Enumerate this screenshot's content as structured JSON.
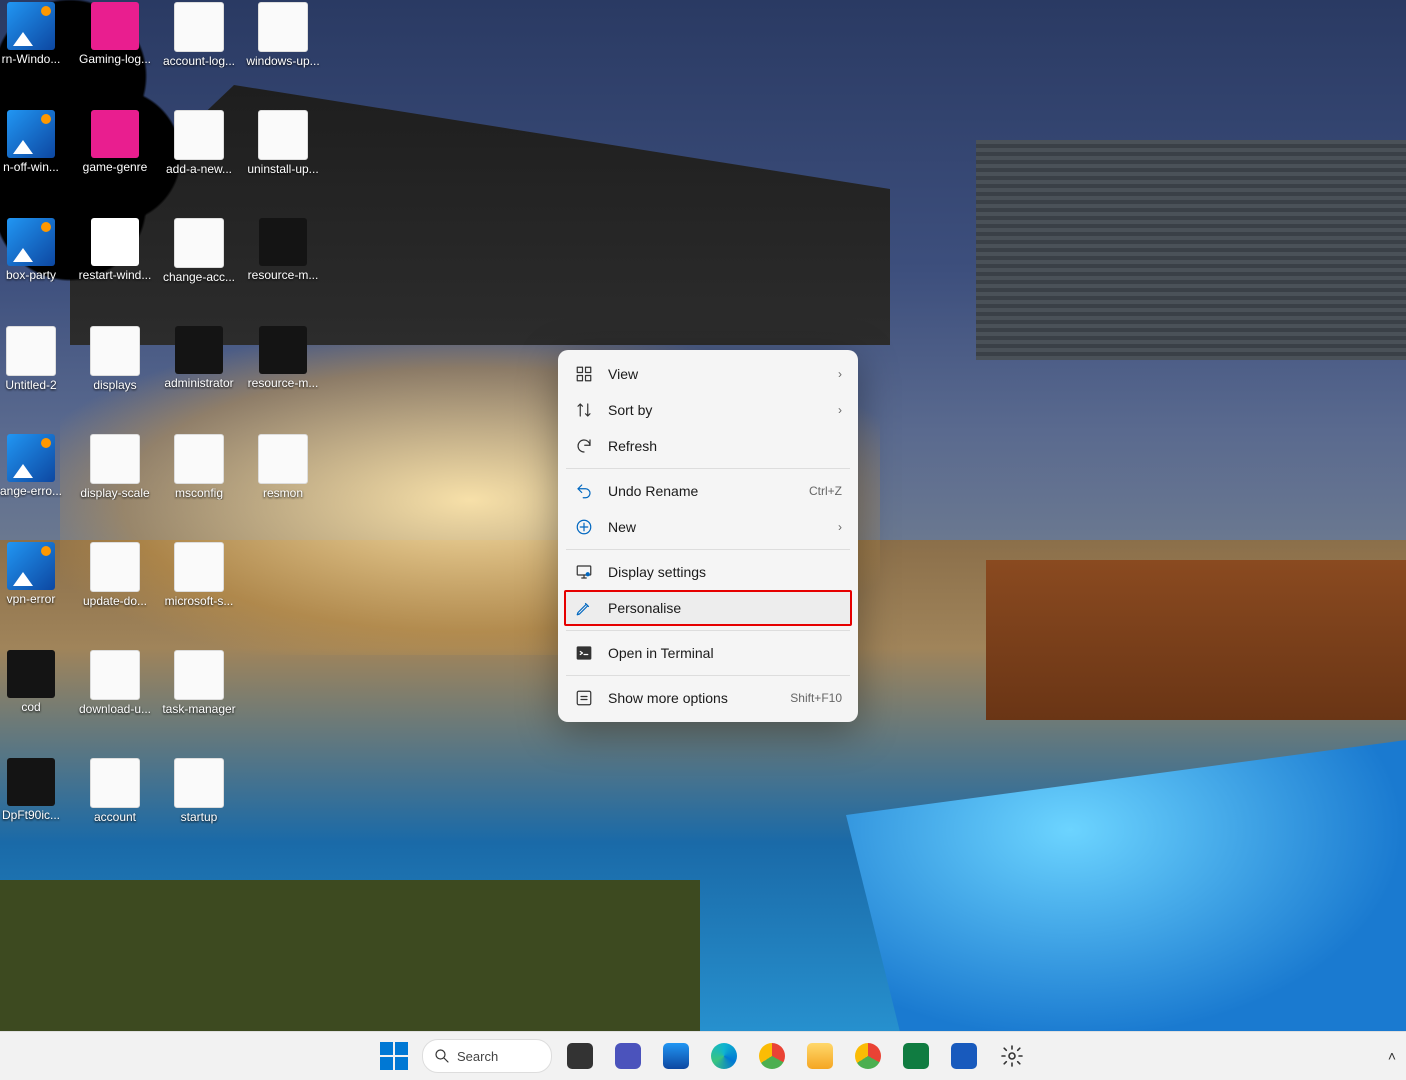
{
  "desktop_icons": [
    [
      {
        "label": "rn-Windo...",
        "type": "image"
      },
      {
        "label": "Gaming-log...",
        "type": "pink"
      },
      {
        "label": "account-log...",
        "type": "doc"
      },
      {
        "label": "windows-up...",
        "type": "doc"
      }
    ],
    [
      {
        "label": "n-off-win...",
        "type": "image"
      },
      {
        "label": "game-genre",
        "type": "pink"
      },
      {
        "label": "add-a-new...",
        "type": "doc"
      },
      {
        "label": "uninstall-up...",
        "type": "doc"
      }
    ],
    [
      {
        "label": "box-party",
        "type": "image"
      },
      {
        "label": "restart-wind...",
        "type": "win"
      },
      {
        "label": "change-acc...",
        "type": "doc"
      },
      {
        "label": "resource-m...",
        "type": "dark"
      }
    ],
    [
      {
        "label": "Untitled-2",
        "type": "doc"
      },
      {
        "label": "displays",
        "type": "doc"
      },
      {
        "label": "administrator",
        "type": "dark"
      },
      {
        "label": "resource-m...",
        "type": "dark"
      }
    ],
    [
      {
        "label": "ange-erro...",
        "type": "image"
      },
      {
        "label": "display-scale",
        "type": "doc"
      },
      {
        "label": "msconfig",
        "type": "doc"
      },
      {
        "label": "resmon",
        "type": "doc"
      }
    ],
    [
      {
        "label": "vpn-error",
        "type": "image"
      },
      {
        "label": "update-do...",
        "type": "doc"
      },
      {
        "label": "microsoft-s...",
        "type": "doc"
      }
    ],
    [
      {
        "label": "cod",
        "type": "dark"
      },
      {
        "label": "download-u...",
        "type": "doc"
      },
      {
        "label": "task-manager",
        "type": "doc"
      }
    ],
    [
      {
        "label": "DpFt90ic...",
        "type": "dark"
      },
      {
        "label": "account",
        "type": "doc"
      },
      {
        "label": "startup",
        "type": "doc"
      }
    ]
  ],
  "context_menu": {
    "view": "View",
    "sort": "Sort by",
    "refresh": "Refresh",
    "undo": "Undo Rename",
    "undo_sc": "Ctrl+Z",
    "new": "New",
    "display": "Display settings",
    "personalise": "Personalise",
    "terminal": "Open in Terminal",
    "more": "Show more options",
    "more_sc": "Shift+F10"
  },
  "taskbar": {
    "search": "Search"
  }
}
